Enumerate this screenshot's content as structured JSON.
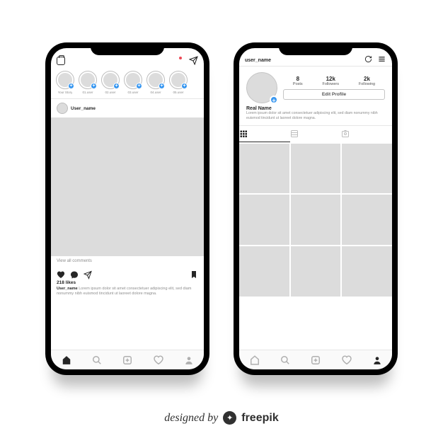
{
  "credit": {
    "prefix": "designed by",
    "brand": "freepik"
  },
  "feed": {
    "stories": [
      {
        "label": "Your Story",
        "has_plus": true
      },
      {
        "label": "01.user",
        "has_plus": true
      },
      {
        "label": "02.user",
        "has_plus": true
      },
      {
        "label": "03.user",
        "has_plus": true
      },
      {
        "label": "04.user",
        "has_plus": true
      },
      {
        "label": "05.user",
        "has_plus": true
      }
    ],
    "post": {
      "author": "User_name",
      "likes": "218 likes",
      "view_comments": "View all comments",
      "caption_author": "User_name",
      "caption_text": "Lorem ipsum dolor sit amet consectetuer adipiscing elit, sed diam nonummy nibh euismod tincidunt ut laoreet dolore magna."
    }
  },
  "profile": {
    "username": "user_name",
    "stats": {
      "posts": {
        "n": "8",
        "label": "Posts"
      },
      "followers": {
        "n": "12k",
        "label": "Followers"
      },
      "following": {
        "n": "2k",
        "label": "Following"
      }
    },
    "edit_label": "Edit Profile",
    "real_name": "Real Name",
    "bio": "Lorem ipsum dolor sit amet consectetuer adipiscing elit, sed diam nonummy nibh euismod tincidunt ut laoreet dolore magna.",
    "grid_count": 9
  }
}
